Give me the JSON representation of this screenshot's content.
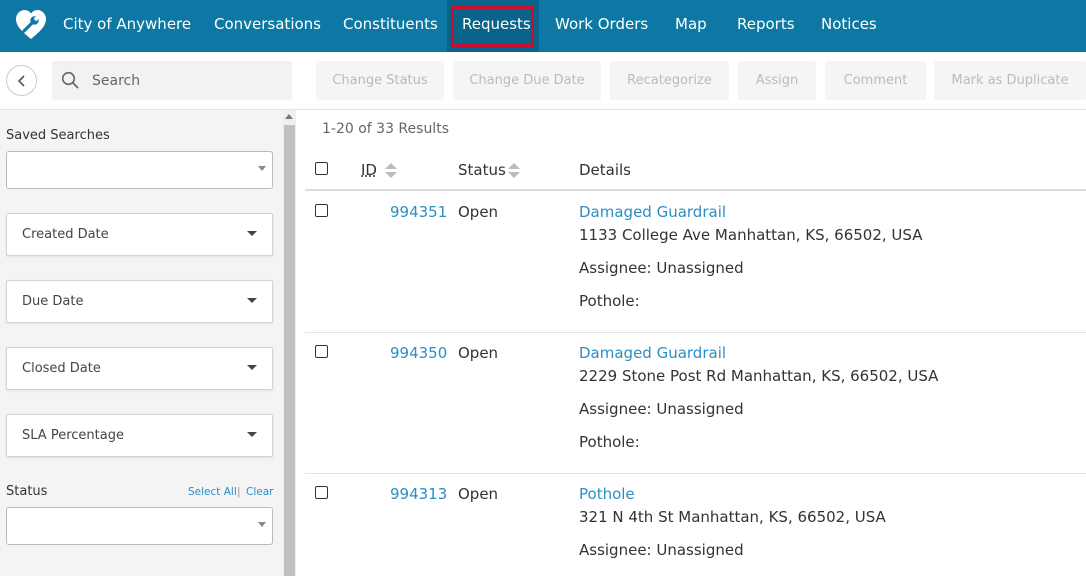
{
  "nav": {
    "app_title": "City of Anywhere",
    "items": [
      "Conversations",
      "Constituents",
      "Requests",
      "Work Orders",
      "Map",
      "Reports",
      "Notices"
    ],
    "active": "Requests",
    "bg_color": "#0d78a3",
    "highlight_color": "#c8102e"
  },
  "toolbar": {
    "search_placeholder": "Search",
    "actions": [
      "Change Status",
      "Change Due Date",
      "Recategorize",
      "Assign",
      "Comment",
      "Mark as Duplicate"
    ]
  },
  "sidebar": {
    "saved_searches_label": "Saved Searches",
    "filters": [
      "Created Date",
      "Due Date",
      "Closed Date",
      "SLA Percentage"
    ],
    "status_label": "Status",
    "select_all": "Select All",
    "separator": "|",
    "clear": "Clear"
  },
  "main": {
    "results_summary": "1-20 of 33 Results",
    "columns": {
      "id": "ID",
      "status": "Status",
      "details": "Details"
    },
    "rows": [
      {
        "id": "994351",
        "status": "Open",
        "title": "Damaged Guardrail",
        "address": "1133 College Ave Manhattan, KS, 66502, USA",
        "assignee": "Assignee: Unassigned",
        "pothole": "Pothole:"
      },
      {
        "id": "994350",
        "status": "Open",
        "title": "Damaged Guardrail",
        "address": "2229 Stone Post Rd Manhattan, KS, 66502, USA",
        "assignee": "Assignee: Unassigned",
        "pothole": "Pothole:"
      },
      {
        "id": "994313",
        "status": "Open",
        "title": "Pothole",
        "address": "321 N 4th St Manhattan, KS, 66502, USA",
        "assignee": "Assignee: Unassigned"
      }
    ]
  }
}
